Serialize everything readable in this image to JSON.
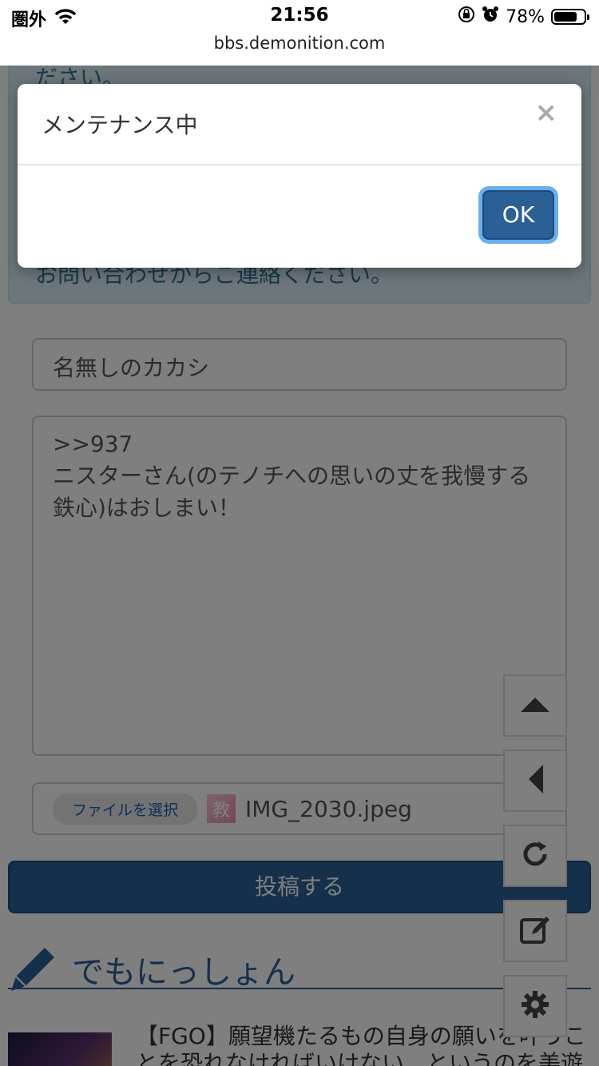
{
  "status_bar": {
    "carrier": "圏外",
    "time": "21:56",
    "battery": "78%",
    "battery_level": 0.78
  },
  "browser": {
    "url": "bbs.demonition.com"
  },
  "page": {
    "alert": {
      "text_top": "ださい。",
      "text_bottom": "お問い合わせからご連絡ください。"
    },
    "form": {
      "name_value": "名無しのカカシ",
      "message_value": ">>937\nニスターさん(のテノチへの思いの丈を我慢する\n鉄心)はおしまい！",
      "file_button": "ファイルを選択",
      "file_thumb_glyph": "教",
      "file_name": "IMG_2030.jpeg",
      "submit_label": "投稿する"
    },
    "section": {
      "title": "でもにっしょん"
    },
    "article": {
      "title": "【FGO】願望機たるもの自身の願いを叶うことを恐れなければいけない…というのを美遊"
    },
    "side_buttons": {
      "top": "arrow-up-icon",
      "back": "arrow-left-icon",
      "reload": "reload-icon",
      "edit": "edit-icon",
      "settings": "gear-icon"
    }
  },
  "modal": {
    "title": "メンテナンス中",
    "close_glyph": "×",
    "ok_label": "OK"
  },
  "colors": {
    "primary": "#2a6096",
    "alert_bg": "#d9edf7",
    "alert_text": "#31708f",
    "focus_ring": "#6aaef0"
  }
}
